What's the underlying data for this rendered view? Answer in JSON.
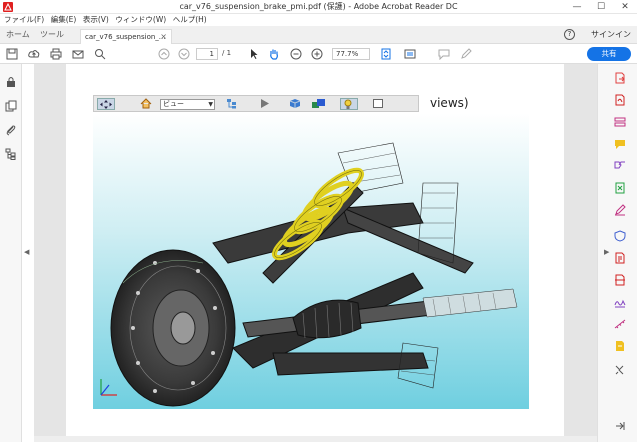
{
  "window": {
    "title": "car_v76_suspension_brake_pmi.pdf (保護) - Adobe Acrobat Reader DC",
    "controls": [
      "—",
      "☐",
      "✕"
    ]
  },
  "menu": [
    "ファイル(F)",
    "編集(E)",
    "表示(V)",
    "ウィンドウ(W)",
    "ヘルプ(H)"
  ],
  "tabs": {
    "home": "ホーム",
    "tools": "ツール",
    "document": "car_v76_suspension_...",
    "close": "×",
    "help": "?",
    "signin": "サインイン"
  },
  "toolbar": {
    "page_current": "1",
    "page_total": "/ 1",
    "zoom": "77.7%",
    "share": "共有"
  },
  "model3d": {
    "view_select": "ビュー",
    "views_text": "views)"
  },
  "colors": {
    "share_blue": "#1473e6",
    "spring_yellow": "#e0d020",
    "sky_cyan": "#6fcfe0"
  }
}
